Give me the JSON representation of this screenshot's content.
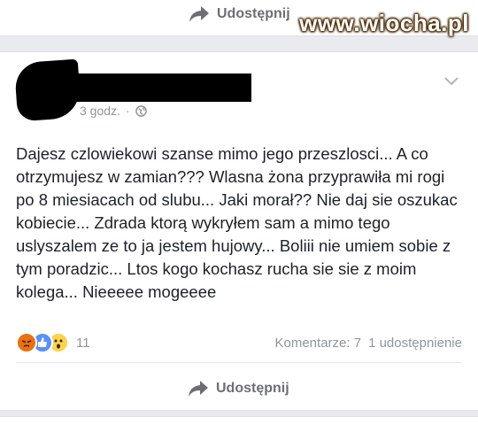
{
  "watermark": "www.wiocha.pl",
  "previous_post": {
    "share_label": "Udostępnij"
  },
  "post": {
    "author_redacted": true,
    "timestamp": "3 godz.",
    "separator": "·",
    "text": "Dajesz czlowiekowi szanse mimo jego przeszlosci... A co otrzymujesz w zamian??? Wlasna żona przyprawiła mi rogi po 8 miesiacach od slubu... Jaki morał?? Nie daj sie oszukac kobiecie... Zdrada ktorą wykryłem sam a mimo tego uslyszalem ze to ja jestem hujowy... Boliii nie umiem sobie z tym poradzic... Ltos kogo kochasz rucha sie sie z moim kolega... Nieeeee mogeeee",
    "reactions": [
      "angry",
      "like",
      "wow"
    ],
    "reaction_count": "11",
    "comments_label": "Komentarze: 7",
    "shares_label": "1 udostępnienie",
    "share_label": "Udostępnij"
  },
  "colors": {
    "background": "#e9ebee",
    "card": "#ffffff",
    "text": "#1d2129",
    "muted": "#90949c",
    "action": "#6b6f75"
  },
  "icons": {
    "share": "share-arrow-icon",
    "privacy": "globe-icon",
    "menu": "chevron-down-icon"
  }
}
